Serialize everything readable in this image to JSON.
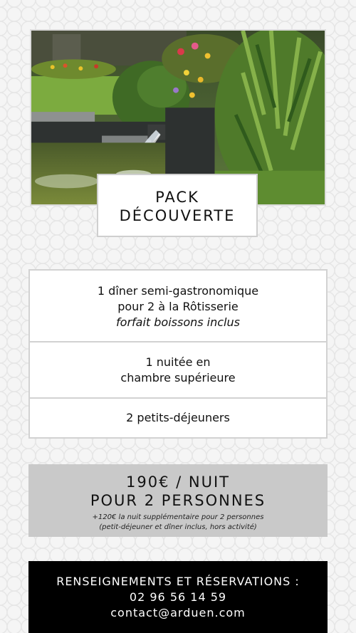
{
  "photo": {
    "subject": "garden-fountain-photo"
  },
  "title": {
    "line1": "PACK",
    "line2": "DÉCOUVERTE"
  },
  "offers": [
    {
      "line1": "1 dîner semi-gastronomique",
      "line2": "pour 2 à la Rôtisserie",
      "note": "forfait boissons inclus"
    },
    {
      "line1": "1 nuitée en",
      "line2": "chambre supérieure"
    },
    {
      "line1": "2 petits-déjeuners"
    }
  ],
  "price": {
    "line1": "190€ / NUIT",
    "line2": "POUR 2 PERSONNES",
    "note1": "+120€ la nuit supplémentaire pour 2 personnes",
    "note2": "(petit-déjeuner et dîner inclus, hors activité)"
  },
  "contact": {
    "heading": "RENSEIGNEMENTS ET RÉSERVATIONS :",
    "phone": "02 96 56 14 59",
    "email": "contact@arduen.com"
  },
  "colors": {
    "price_band": "#c9c9c9",
    "contact_band": "#000000",
    "text": "#111111",
    "background": "#f5f5f5"
  }
}
